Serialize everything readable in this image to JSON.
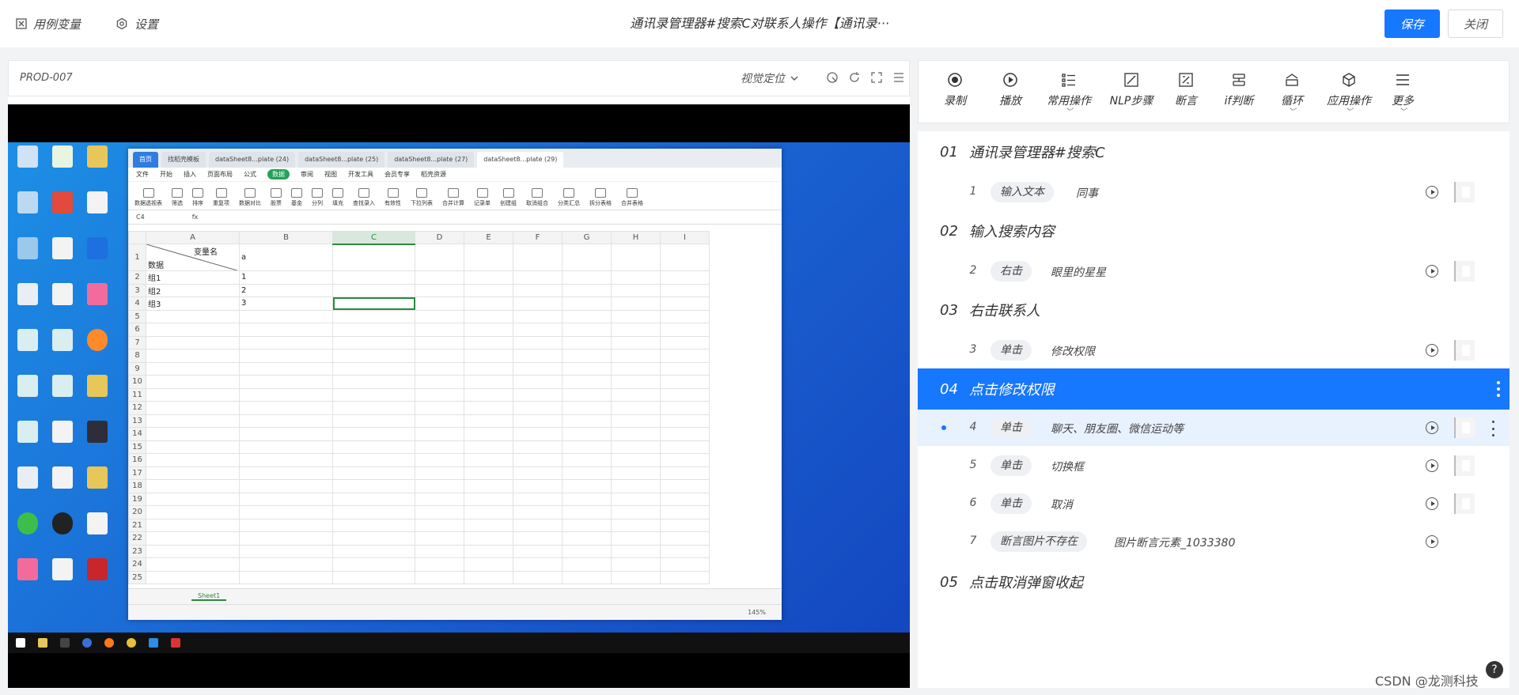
{
  "header": {
    "variables_label": "用例变量",
    "settings_label": "设置",
    "title": "通讯录管理器#搜索C对联系人操作【通讯录···",
    "save_label": "保存",
    "close_label": "关闭"
  },
  "left": {
    "case_id": "PROD-007",
    "visual_locate_label": "视觉定位"
  },
  "spreadsheet": {
    "tabs": [
      "首页",
      "找稻壳模板",
      "dataSheet8...plate (24)",
      "dataSheet8...plate (25)",
      "dataSheet8...plate (27)",
      "dataSheet8...plate (29)"
    ],
    "menu": [
      "文件",
      "开始",
      "插入",
      "页面布局",
      "公式",
      "数据",
      "审阅",
      "视图",
      "开发工具",
      "会员专享",
      "稻壳资源"
    ],
    "active_menu": "数据",
    "ribbon": [
      "数据透视表",
      "筛选",
      "排序",
      "重复项",
      "数据对比",
      "股票",
      "基金",
      "分列",
      "填充",
      "查找录入",
      "有效性",
      "下拉列表",
      "合并计算",
      "记录单",
      "创建组",
      "取消组合",
      "分类汇总",
      "拆分表格",
      "合并表格"
    ],
    "cell_ref": "C4",
    "fx": "fx",
    "columns": [
      "A",
      "B",
      "C",
      "D",
      "E",
      "F",
      "G",
      "H",
      "I"
    ],
    "header_diag_top": "变量名",
    "header_diag_bottom": "数据",
    "b1": "a",
    "rows": [
      {
        "a": "组1",
        "b": "1"
      },
      {
        "a": "组2",
        "b": "2"
      },
      {
        "a": "组3",
        "b": "3"
      }
    ],
    "row_numbers": [
      "1",
      "2",
      "3",
      "4",
      "5",
      "6",
      "7",
      "8",
      "9",
      "10",
      "11",
      "12",
      "13",
      "14",
      "15",
      "16",
      "17",
      "18",
      "19",
      "20",
      "21",
      "22",
      "23",
      "24",
      "25"
    ],
    "sheet_tab": "Sheet1",
    "zoom": "145%"
  },
  "toolbar": {
    "items": [
      {
        "label": "录制",
        "icon": "record-icon"
      },
      {
        "label": "播放",
        "icon": "play-icon"
      },
      {
        "label": "常用操作",
        "icon": "list-icon"
      },
      {
        "label": "NLP步骤",
        "icon": "nlp-icon"
      },
      {
        "label": "断言",
        "icon": "assert-icon"
      },
      {
        "label": "if判断",
        "icon": "if-icon"
      },
      {
        "label": "循环",
        "icon": "loop-icon"
      },
      {
        "label": "应用操作",
        "icon": "app-icon"
      },
      {
        "label": "更多",
        "icon": "menu-icon"
      }
    ]
  },
  "steps": {
    "groups": [
      {
        "no": "01",
        "title": "通讯录管理器#搜索C"
      },
      {
        "no": "02",
        "title": "输入搜索内容"
      },
      {
        "no": "03",
        "title": "右击联系人"
      },
      {
        "no": "04",
        "title": "点击修改权限"
      },
      {
        "no": "05",
        "title": "点击取消弹窗收起"
      }
    ],
    "items": [
      {
        "idx": "1",
        "action": "输入文本",
        "target": "同事"
      },
      {
        "idx": "2",
        "action": "右击",
        "target": "眼里的星星"
      },
      {
        "idx": "3",
        "action": "单击",
        "target": "修改权限"
      },
      {
        "idx": "4",
        "action": "单击",
        "target": "聊天、朋友圈、微信运动等"
      },
      {
        "idx": "5",
        "action": "单击",
        "target": "切换框"
      },
      {
        "idx": "6",
        "action": "单击",
        "target": "取消"
      },
      {
        "idx": "7",
        "action": "断言图片不存在",
        "target": "图片断言元素_1033380"
      }
    ]
  },
  "watermark": "CSDN @龙测科技",
  "colors": {
    "accent": "#1677ff",
    "highlight": "#e8f1fe",
    "sheet_green": "#2b8a3e"
  }
}
